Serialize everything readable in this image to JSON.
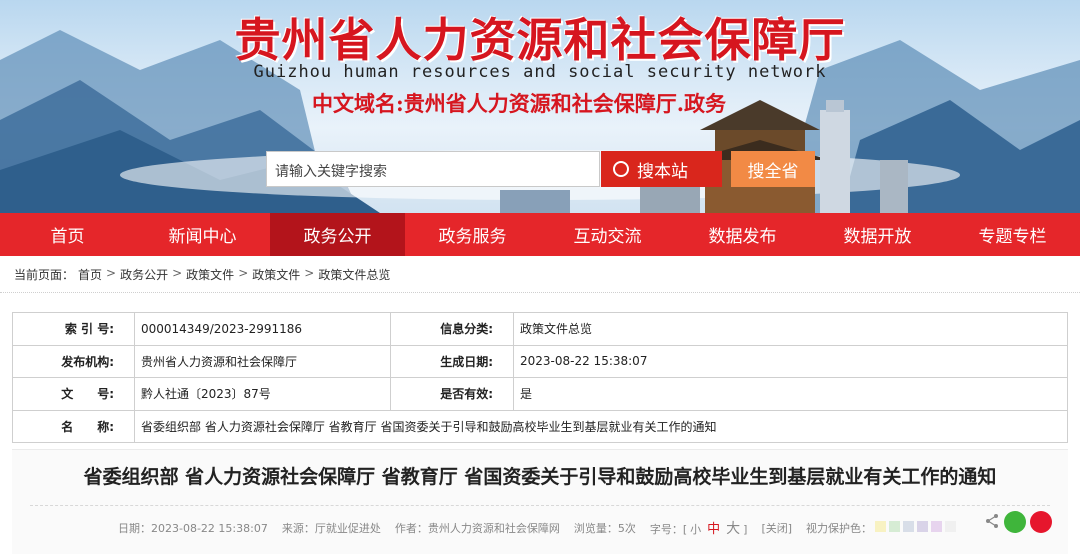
{
  "header": {
    "title": "贵州省人力资源和社会保障厅",
    "subtitle_en": "Guizhou human resources and social security network",
    "domain_label": "中文域名:贵州省人力资源和社会保障厅.政务"
  },
  "search": {
    "placeholder": "请输入关键字搜索",
    "site_button": "搜本站",
    "province_button": "搜全省"
  },
  "nav": {
    "items": [
      "首页",
      "新闻中心",
      "政务公开",
      "政务服务",
      "互动交流",
      "数据发布",
      "数据开放",
      "专题专栏"
    ],
    "active": "政务公开"
  },
  "breadcrumb": {
    "prefix": "当前页面：",
    "items": [
      "首页",
      "政务公开",
      "政策文件",
      "政策文件",
      "政策文件总览"
    ],
    "separator": ">"
  },
  "info": {
    "index_label": "索 引 号:",
    "index_value": "000014349/2023-2991186",
    "category_label": "信息分类:",
    "category_value": "政策文件总览",
    "issuer_label": "发布机构:",
    "issuer_value": "贵州省人力资源和社会保障厅",
    "date_label": "生成日期:",
    "date_value": "2023-08-22 15:38:07",
    "doc_label": "文　　号:",
    "doc_value": "黔人社通〔2023〕87号",
    "valid_label": "是否有效:",
    "valid_value": "是",
    "name_label": "名　　称:",
    "name_value": "省委组织部 省人力资源社会保障厅 省教育厅 省国资委关于引导和鼓励高校毕业生到基层就业有关工作的通知"
  },
  "article": {
    "title": "省委组织部 省人力资源社会保障厅 省教育厅 省国资委关于引导和鼓励高校毕业生到基层就业有关工作的通知",
    "date_label": "日期：",
    "date": "2023-08-22 15:38:07",
    "source_label": "来源：",
    "source": "厅就业促进处",
    "author_label": "作者：",
    "author": "贵州人力资源和社会保障网",
    "views_label": "浏览量：",
    "views": "5次",
    "font_label": "字号：",
    "font_open": "[",
    "font_small": "小",
    "font_mid": "中",
    "font_big": "大",
    "font_close": "]",
    "close_label": "[关闭]",
    "eye_label": "视力保护色：",
    "eye_colors": [
      "#f8f2c2",
      "#d6ecd4",
      "#d8dee8",
      "#d9d3e8",
      "#e7d4ee",
      "#f0f0f0"
    ]
  },
  "colors": {
    "brand_red": "#e5262a",
    "nav_active": "#b3141b",
    "search_red": "#d9261c",
    "search_orange": "#f28a45"
  }
}
